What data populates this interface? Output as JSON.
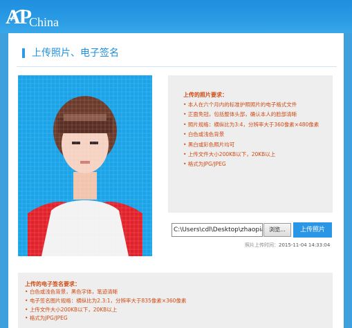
{
  "brand": {
    "logo_ap": "AP",
    "logo_china": "China"
  },
  "section": {
    "title": "上传照片、电子签名"
  },
  "photo": {
    "icon": "person-portrait-photo",
    "background": "#1aa3e8"
  },
  "photo_requirements": {
    "title": "上传的照片要求：",
    "items": [
      "本人在六个月内的标准护照照片的电子格式文件",
      "正面免冠，包括整体头部，确认本人的脸部清晰",
      "照片规格：横纵比为3:4，分辨率大于360像素×480像素",
      "白色或浅色背景",
      "黑白或彩色照片均可",
      "上传文件大小200KB以下，20KB以上",
      "格式为JPG/JPEG"
    ]
  },
  "upload": {
    "file_value": "C:\\Users\\cdl\\Desktop\\zhaopian",
    "browse_label": "浏览...",
    "upload_label": "上传照片",
    "time_label": "照片上传时间：",
    "time_value": "2015-11-04 14:33:04"
  },
  "signature_requirements": {
    "title": "上传的电子签名要求：",
    "items": [
      "白色或浅色背景，黑色字体，笔迹清晰",
      "电子签名图片规格：横纵比为2.3:1，分辨率大于835像素×360像素",
      "上传文件大小200KB以下，20KB以上",
      "格式为JPG/JPEG"
    ]
  },
  "colors": {
    "accent": "#2a9be4",
    "warning_text": "#d04a12",
    "panel_bg": "#eeeeee"
  }
}
